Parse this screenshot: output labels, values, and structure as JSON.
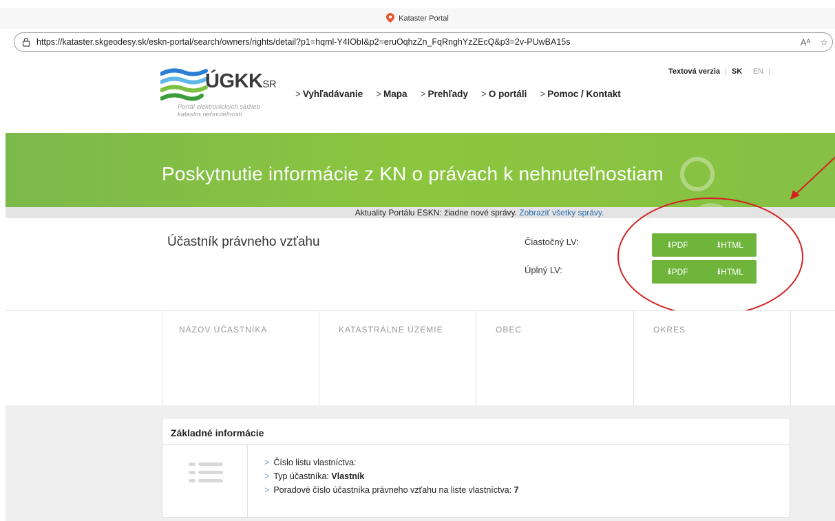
{
  "browser": {
    "tab_title": "Kataster Portal",
    "url": "https://kataster.skgeodesy.sk/eskn-portal/search/owners/rights/detail?p1=hqml-Y4IObI&p2=eruOqhzZn_FqRnghYzZEcQ&p3=2v-PUwBA15s",
    "read_aloud_label": "Aᴬ",
    "favorite_icon": "☆"
  },
  "header": {
    "logo_main": "ÚGKK",
    "logo_suffix": "SR",
    "logo_subtitle_1": "Portál elektronických služieb",
    "logo_subtitle_2": "katastra nehnuteľností",
    "nav": [
      {
        "label": "Vyhľadávanie"
      },
      {
        "label": "Mapa"
      },
      {
        "label": "Prehľady"
      },
      {
        "label": "O portáli"
      },
      {
        "label": "Pomoc / Kontakt"
      }
    ],
    "text_version": "Textová verzia",
    "lang_sk": "SK",
    "lang_en": "EN"
  },
  "banner": {
    "title": "Poskytnutie informácie z KN o právach k nehnuteľnostiam"
  },
  "news": {
    "text": "Aktuality Portálu ESKN: žiadne nové správy.",
    "link": "Zobraziť všetky správy."
  },
  "participant": {
    "title": "Účastník právneho vzťahu",
    "partial_label": "Čiastočný LV:",
    "full_label": "Úplný LV:",
    "pdf_label": "PDF",
    "html_label": "HTML",
    "download_glyph": "⭳"
  },
  "table": {
    "columns": [
      "NÁZOV ÚČASTNÍKA",
      "KATASTRÁLNE ÚZEMIE",
      "OBEC",
      "OKRES"
    ]
  },
  "basic_info": {
    "title": "Základné informácie",
    "items": [
      {
        "label": "Číslo listu vlastníctva:",
        "value": ""
      },
      {
        "label": "Typ účastníka:",
        "value": "Vlastník"
      },
      {
        "label": "Poradové číslo účastníka právneho vzťahu na liste vlastníctva:",
        "value": "7"
      }
    ]
  },
  "colors": {
    "banner_green": "#8cc63f",
    "button_green": "#6fb53c",
    "annotation_red": "#d42020",
    "link_blue": "#2b6cb0"
  }
}
